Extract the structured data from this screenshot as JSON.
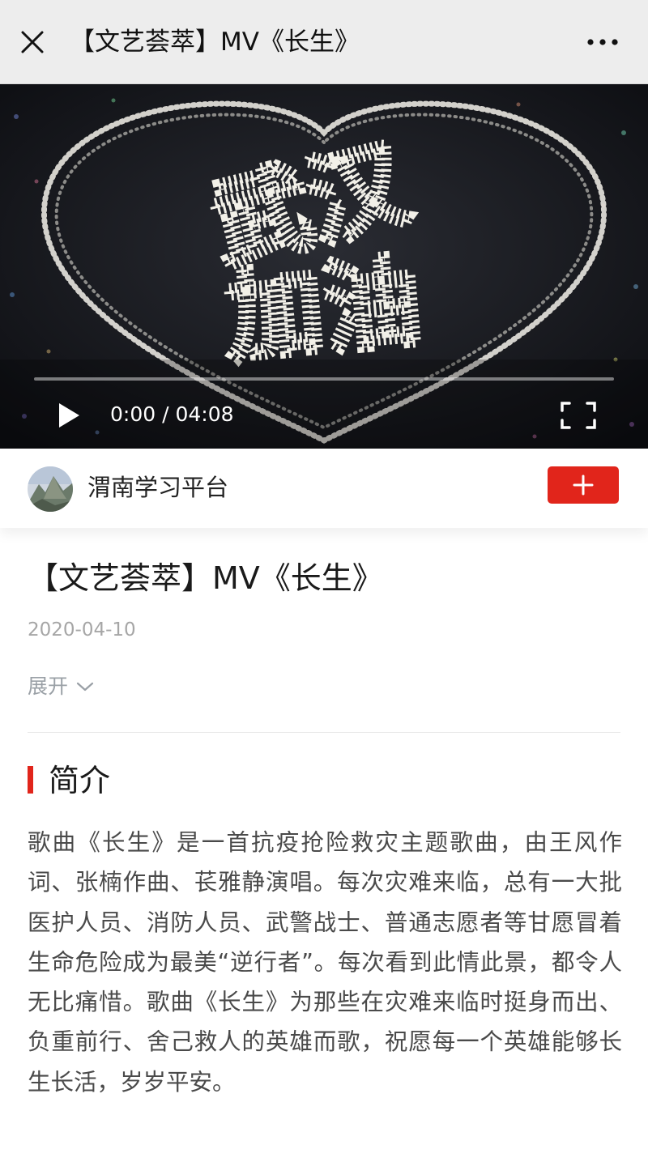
{
  "topbar": {
    "title": "【文艺荟萃】MV《长生》",
    "close_icon": "close-icon",
    "more_icon": "more-dots-icon"
  },
  "video": {
    "overlay_text_line1": "武汉",
    "overlay_text_line2": "加油",
    "time": "0:00 / 04:08",
    "progress": 0,
    "play_icon": "play-icon",
    "fullscreen_icon": "fullscreen-icon"
  },
  "account": {
    "name": "渭南学习平台",
    "avatar_icon": "mountain-avatar",
    "follow_icon": "plus-icon",
    "accent_color": "#e1251b"
  },
  "article": {
    "title": "【文艺荟萃】MV《长生》",
    "date": "2020-04-10",
    "expand_label": "展开",
    "expand_icon": "chevron-down-icon"
  },
  "intro": {
    "heading": "简介",
    "text": "歌曲《长生》是一首抗疫抢险救灾主题歌曲，由王风作词、张楠作曲、苌雅静演唱。每次灾难来临，总有一大批医护人员、消防人员、武警战士、普通志愿者等甘愿冒着生命危险成为最美“逆行者”。每次看到此情此景，都令人无比痛惜。歌曲《长生》为那些在灾难来临时挺身而出、负重前行、舍己救人的英雄而歌，祝愿每一个英雄能够长生长活，岁岁平安。"
  }
}
